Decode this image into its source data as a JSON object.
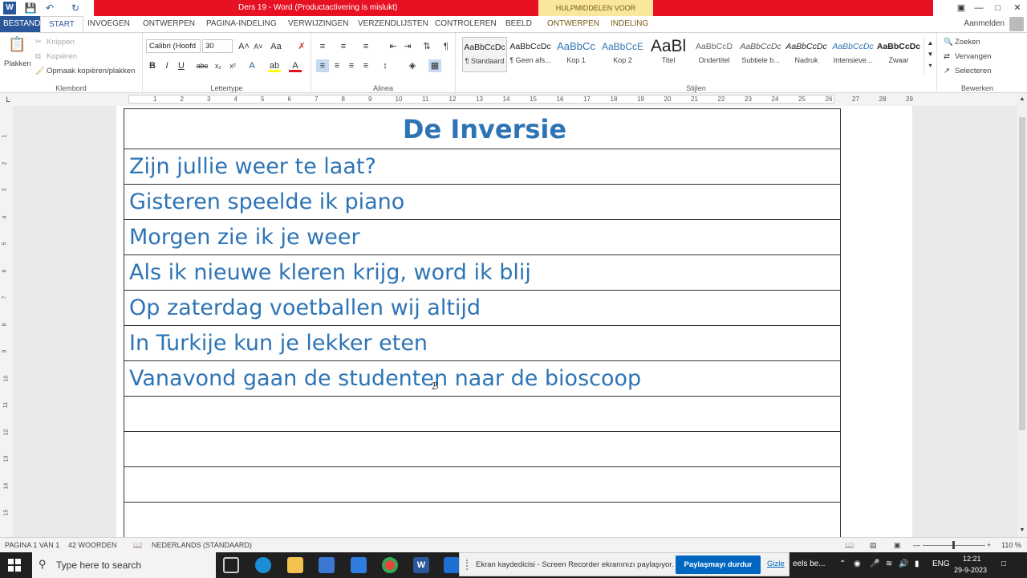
{
  "titlebar": {
    "title": "Ders 19 - Word (Productactivering is mislukt)",
    "context_label": "HULPMIDDELEN VOOR TABELLEN",
    "help": "?"
  },
  "tabs": {
    "file": "BESTAND",
    "items": [
      "START",
      "INVOEGEN",
      "ONTWERPEN",
      "PAGINA-INDELING",
      "VERWIJZINGEN",
      "VERZENDLIJSTEN",
      "CONTROLEREN",
      "BEELD"
    ],
    "context": [
      "ONTWERPEN",
      "INDELING"
    ],
    "signin": "Aanmelden"
  },
  "ribbon": {
    "clipboard": {
      "paste": "Plakken",
      "cut": "Knippen",
      "copy": "Kopiëren",
      "format_painter": "Opmaak kopiëren/plakken",
      "label": "Klembord"
    },
    "font": {
      "name": "Calibri (Hoofd",
      "size": "30",
      "label": "Lettertype"
    },
    "paragraph": {
      "label": "Alinea"
    },
    "styles": {
      "label": "Stijlen",
      "items": [
        {
          "preview": "AaBbCcDc",
          "name": "¶ Standaard"
        },
        {
          "preview": "AaBbCcDc",
          "name": "¶ Geen afs..."
        },
        {
          "preview": "AaBbCc",
          "name": "Kop 1"
        },
        {
          "preview": "AaBbCcE",
          "name": "Kop 2"
        },
        {
          "preview": "AaBl",
          "name": "Titel"
        },
        {
          "preview": "AaBbCcD",
          "name": "Ondertitel"
        },
        {
          "preview": "AaBbCcDc",
          "name": "Subtiele b..."
        },
        {
          "preview": "AaBbCcDc",
          "name": "Nadruk"
        },
        {
          "preview": "AaBbCcDc",
          "name": "Intensieve..."
        },
        {
          "preview": "AaBbCcDc",
          "name": "Zwaar"
        }
      ]
    },
    "editing": {
      "find": "Zoeken",
      "replace": "Vervangen",
      "select": "Selecteren",
      "label": "Bewerken"
    }
  },
  "ruler": {
    "ticks": [
      "1",
      "2",
      "3",
      "4",
      "5",
      "6",
      "7",
      "8",
      "9",
      "10",
      "11",
      "12",
      "13",
      "14",
      "15",
      "16",
      "17",
      "18",
      "19",
      "20",
      "21",
      "22",
      "23",
      "24",
      "25",
      "26",
      "27",
      "28",
      "29"
    ],
    "vticks": [
      "1",
      "2",
      "3",
      "4",
      "5",
      "6",
      "7",
      "8",
      "9",
      "10",
      "11",
      "12",
      "13",
      "14",
      "15"
    ]
  },
  "document": {
    "heading": "De Inversie",
    "rows": [
      "Zijn jullie weer te laat?",
      "Gisteren speelde ik piano",
      "Morgen zie ik je weer",
      "Als ik nieuwe kleren krijg, word ik blij",
      "Op zaterdag voetballen wij altijd",
      "In Turkije kun je lekker eten",
      "Vanavond gaan de studenten naar de bioscoop",
      "",
      "",
      "",
      ""
    ]
  },
  "statusbar": {
    "page": "PAGINA 1 VAN 1",
    "words": "42 WOORDEN",
    "language": "NEDERLANDS (STANDAARD)",
    "zoom": "110 %"
  },
  "taskbar": {
    "search_placeholder": "Type here to search",
    "recorder_text": "Ekran kaydedicisi - Screen Recorder ekranınızı paylaşıyor.",
    "stop_label": "Paylaşmayı durdur",
    "hide_label": "Gizle",
    "app_label": "eels be...",
    "lang": "ENG",
    "time": "12:21",
    "date": "29-9-2023"
  },
  "colors": {
    "accent": "#2b579a",
    "title_red": "#e81123",
    "doc_text": "#2e74b5"
  }
}
